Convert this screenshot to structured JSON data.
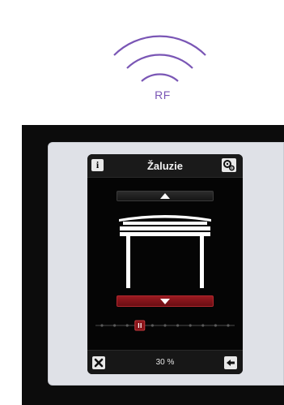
{
  "rf_badge": {
    "label": "RF",
    "icon": "wireless-signal-icon"
  },
  "device": {
    "title": "Žaluzie",
    "position_label": "30 %",
    "position_percent": 30,
    "info_label": "i"
  },
  "icons": {
    "info": "info-icon",
    "settings": "gears-icon",
    "up": "arrow-up-icon",
    "down": "arrow-down-icon",
    "close": "close-icon",
    "back": "arrow-left-icon",
    "blind": "blind-icon"
  },
  "colors": {
    "rf_accent": "#7a56b5",
    "active_red": "#8a1419",
    "screen_bg": "#050505",
    "frame": "#dfe1e7"
  }
}
